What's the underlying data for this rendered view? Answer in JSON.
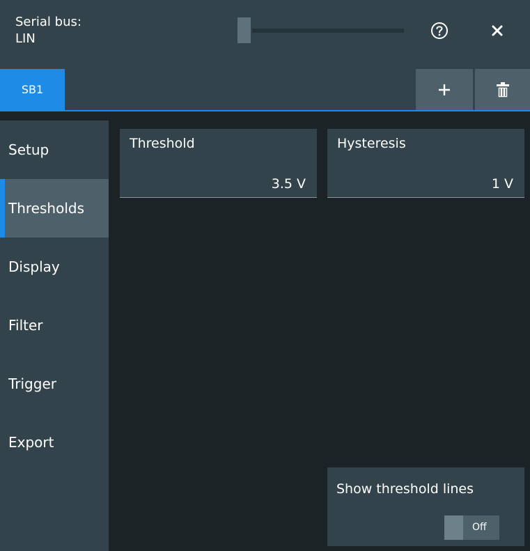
{
  "header": {
    "title_line1": "Serial bus:",
    "title_line2": "LIN",
    "icons": {
      "help": "help-circle-icon",
      "close": "close-icon"
    }
  },
  "tabs": {
    "items": [
      {
        "label": "SB1",
        "active": true
      }
    ],
    "icons": {
      "add": "plus-icon",
      "delete": "trash-icon"
    }
  },
  "sidebar": {
    "items": [
      {
        "label": "Setup",
        "active": false
      },
      {
        "label": "Thresholds",
        "active": true
      },
      {
        "label": "Display",
        "active": false
      },
      {
        "label": "Filter",
        "active": false
      },
      {
        "label": "Trigger",
        "active": false
      },
      {
        "label": "Export",
        "active": false
      }
    ]
  },
  "main": {
    "threshold": {
      "label": "Threshold",
      "value": "3.5 V"
    },
    "hysteresis": {
      "label": "Hysteresis",
      "value": "1 V"
    },
    "show_threshold_lines": {
      "label": "Show threshold lines",
      "state": "Off"
    }
  },
  "colors": {
    "accent": "#1e8ce6",
    "panel": "#33434b",
    "background": "#1c2327",
    "button": "#4e616b"
  }
}
